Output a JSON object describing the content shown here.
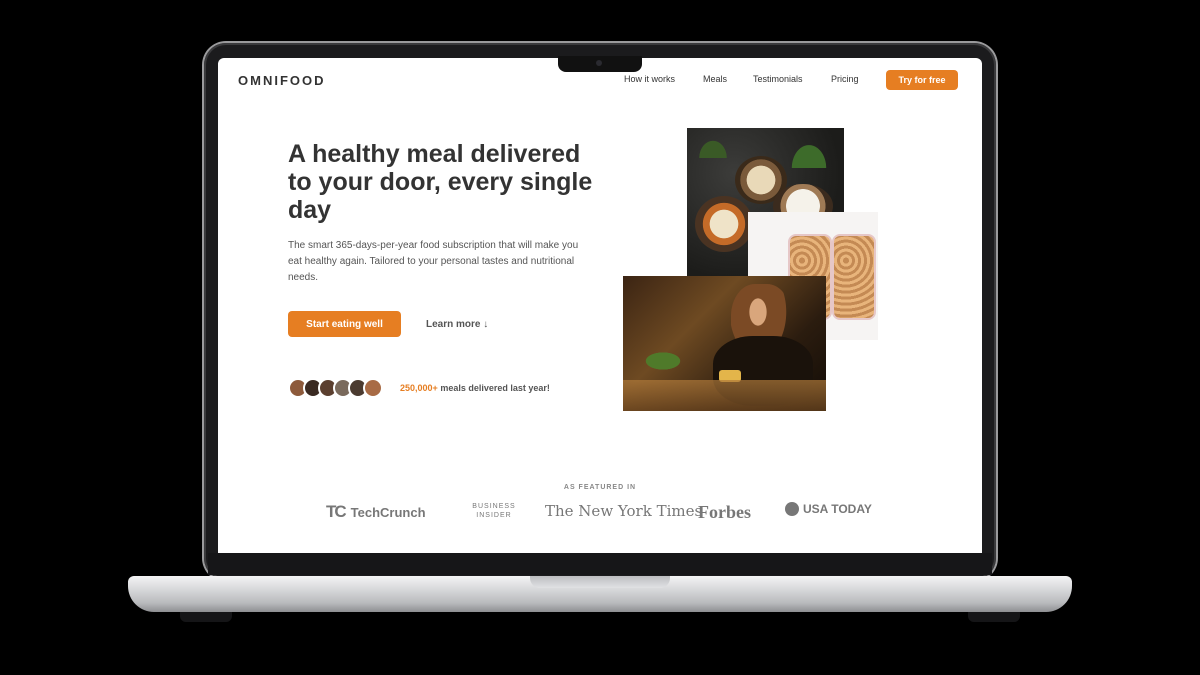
{
  "brand": {
    "logo_text": "OMNIFOOD",
    "accent_color": "#e67e22"
  },
  "nav": {
    "items": [
      "How it works",
      "Meals",
      "Testimonials",
      "Pricing"
    ],
    "cta": "Try for free"
  },
  "hero": {
    "title": "A healthy meal delivered to your door, every single day",
    "description": "The smart 365-days-per-year food subscription that will make you eat healthy again. Tailored to your personal tastes and nutritional needs.",
    "primary_button": "Start eating well",
    "secondary_button": "Learn more ↓",
    "delivered_highlight": "250,000+",
    "delivered_text": "meals delivered last year!"
  },
  "customers": {
    "avatar_colors": [
      "#8d5a3b",
      "#3a2a22",
      "#5b3f2f",
      "#7a6a5c",
      "#4b3b30",
      "#a86b45"
    ]
  },
  "images": [
    {
      "name": "bowls-image"
    },
    {
      "name": "meal-boxes-image"
    },
    {
      "name": "woman-eating-image"
    }
  ],
  "featured": {
    "label": "AS FEATURED IN",
    "logos": [
      "TechCrunch",
      "BUSINESS INSIDER",
      "The New York Times",
      "Forbes",
      "USA TODAY"
    ]
  }
}
